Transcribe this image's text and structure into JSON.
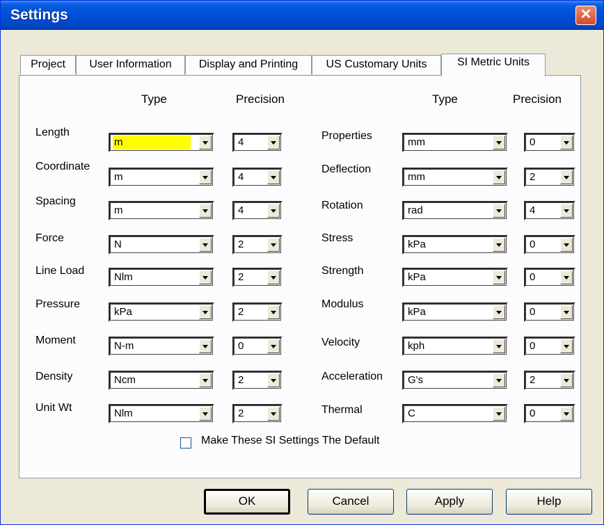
{
  "window": {
    "title": "Settings"
  },
  "tabs": [
    "Project",
    "User Information",
    "Display and Printing",
    "US Customary Units",
    "SI Metric Units"
  ],
  "headers": {
    "type": "Type",
    "precision": "Precision"
  },
  "left": [
    {
      "label": "Length",
      "type": "m",
      "precision": "4"
    },
    {
      "label": "Coordinate",
      "type": "m",
      "precision": "4"
    },
    {
      "label": "Spacing",
      "type": "m",
      "precision": "4"
    },
    {
      "label": "Force",
      "type": "N",
      "precision": "2"
    },
    {
      "label": "Line Load",
      "type": "Nlm",
      "precision": "2"
    },
    {
      "label": "Pressure",
      "type": "kPa",
      "precision": "2"
    },
    {
      "label": "Moment",
      "type": "N-m",
      "precision": "0"
    },
    {
      "label": "Density",
      "type": "Ncm",
      "precision": "2"
    },
    {
      "label": "Unit Wt",
      "type": "Nlm",
      "precision": "2"
    }
  ],
  "right": [
    {
      "label": "Properties",
      "type": "mm",
      "precision": "0"
    },
    {
      "label": "Deflection",
      "type": "mm",
      "precision": "2"
    },
    {
      "label": "Rotation",
      "type": "rad",
      "precision": "4"
    },
    {
      "label": "Stress",
      "type": "kPa",
      "precision": "0"
    },
    {
      "label": "Strength",
      "type": "kPa",
      "precision": "0"
    },
    {
      "label": "Modulus",
      "type": "kPa",
      "precision": "0"
    },
    {
      "label": "Velocity",
      "type": "kph",
      "precision": "0"
    },
    {
      "label": "Acceleration",
      "type": "G's",
      "precision": "2"
    },
    {
      "label": "Thermal",
      "type": "C",
      "precision": "0"
    }
  ],
  "default_checkbox": {
    "label": "Make These SI Settings The Default",
    "checked": false
  },
  "buttons": {
    "ok": "OK",
    "cancel": "Cancel",
    "apply": "Apply",
    "help": "Help"
  },
  "close_glyph": "✕"
}
